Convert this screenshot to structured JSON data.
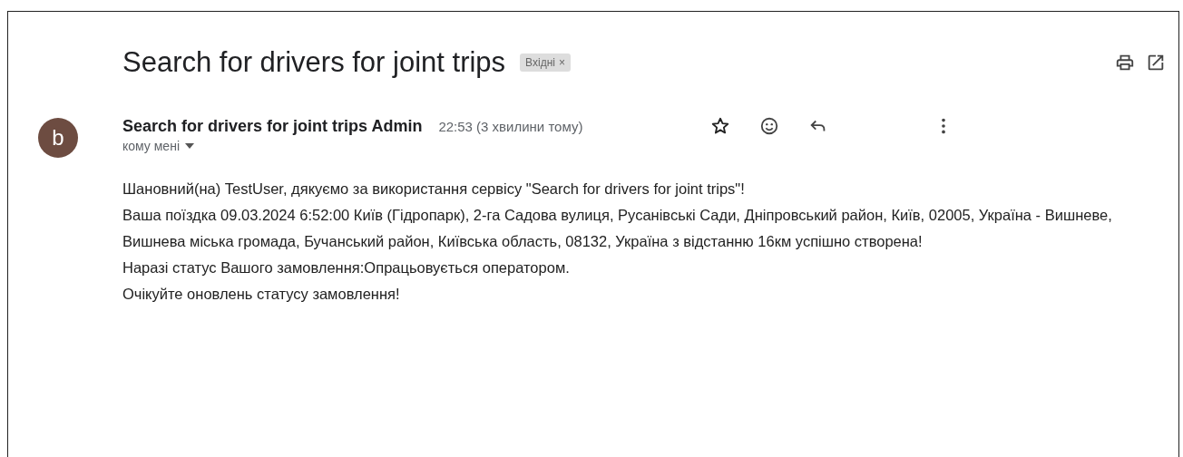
{
  "subject": "Search for drivers for joint trips",
  "label": {
    "text": "Вхідні",
    "close": "×"
  },
  "sender": {
    "initial": "b",
    "name": "Search for drivers for joint trips Admin",
    "time": "22:53 (3 хвилини тому)",
    "recipient": "кому мені"
  },
  "body": [
    "Шановний(на) TestUser, дякуємо за використання сервісу \"Search for drivers for joint trips\"!",
    "Ваша поїздка 09.03.2024 6:52:00 Київ (Гідропарк), 2-га Садова вулиця, Русанівські Сади, Дніпровський район, Київ, 02005, Україна - Вишневе, Вишнева міська громада, Бучанський район, Київська область, 08132, Україна з відстанню 16км успішно створена!",
    "Наразі статус Вашого замовлення:Опрацьовується оператором.",
    "Очікуйте оновлень статусу замовлення!"
  ]
}
